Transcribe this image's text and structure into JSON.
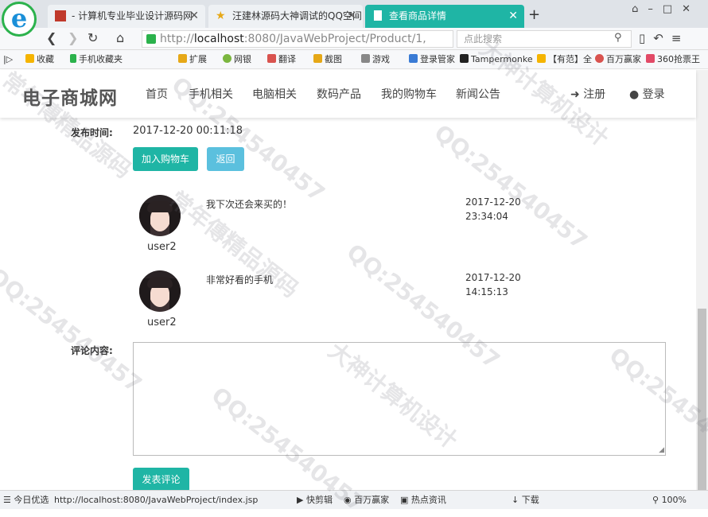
{
  "browser": {
    "tabs": [
      {
        "label": "- 计算机专业毕业设计源码网"
      },
      {
        "label": "汪建林源码大神调试的QQ空间"
      },
      {
        "label": "查看商品详情"
      }
    ],
    "new_tab": "+",
    "address": {
      "prefix": "http://",
      "host": "localhost",
      "rest": ":8080/JavaWebProject/Product/1,"
    },
    "search_placeholder": "点此搜索",
    "bookmarks": [
      "收藏",
      "手机收藏夹",
      "扩展",
      "网银",
      "翻译",
      "截图",
      "游戏",
      "登录管家",
      "Tampermonke",
      "【有范】全",
      "百万赢家",
      "360抢票王"
    ]
  },
  "site": {
    "brand": "电子商城网",
    "menu": [
      "首页",
      "手机相关",
      "电脑相关",
      "数码产品",
      "我的购物车",
      "新闻公告"
    ],
    "register": "注册",
    "login": "登录"
  },
  "product": {
    "publish_label": "发布时间:",
    "publish_time": "2017-12-20 00:11:18",
    "add_cart_button": "加入购物车",
    "back_button": "返回"
  },
  "comments": [
    {
      "user": "user2",
      "text": "我下次还会来买的！",
      "date": "2017-12-20",
      "time": "23:34:04"
    },
    {
      "user": "user2",
      "text": "非常好看的手机",
      "date": "2017-12-20",
      "time": "14:15:13"
    }
  ],
  "comment_form": {
    "label": "评论内容:",
    "value": "",
    "submit_button": "发表评论"
  },
  "status_bar": {
    "today": "今日优选",
    "url": "http://localhost:8080/JavaWebProject/index.jsp",
    "items": [
      "快剪辑",
      "百万赢家",
      "热点资讯",
      "下载"
    ],
    "zoom": "100%"
  },
  "watermarks": [
    "常年傳精品源码",
    "QQ:254540457",
    "大神计算机设计"
  ],
  "colors": {
    "accent": "#1fb5a5",
    "info": "#5bc0de"
  }
}
